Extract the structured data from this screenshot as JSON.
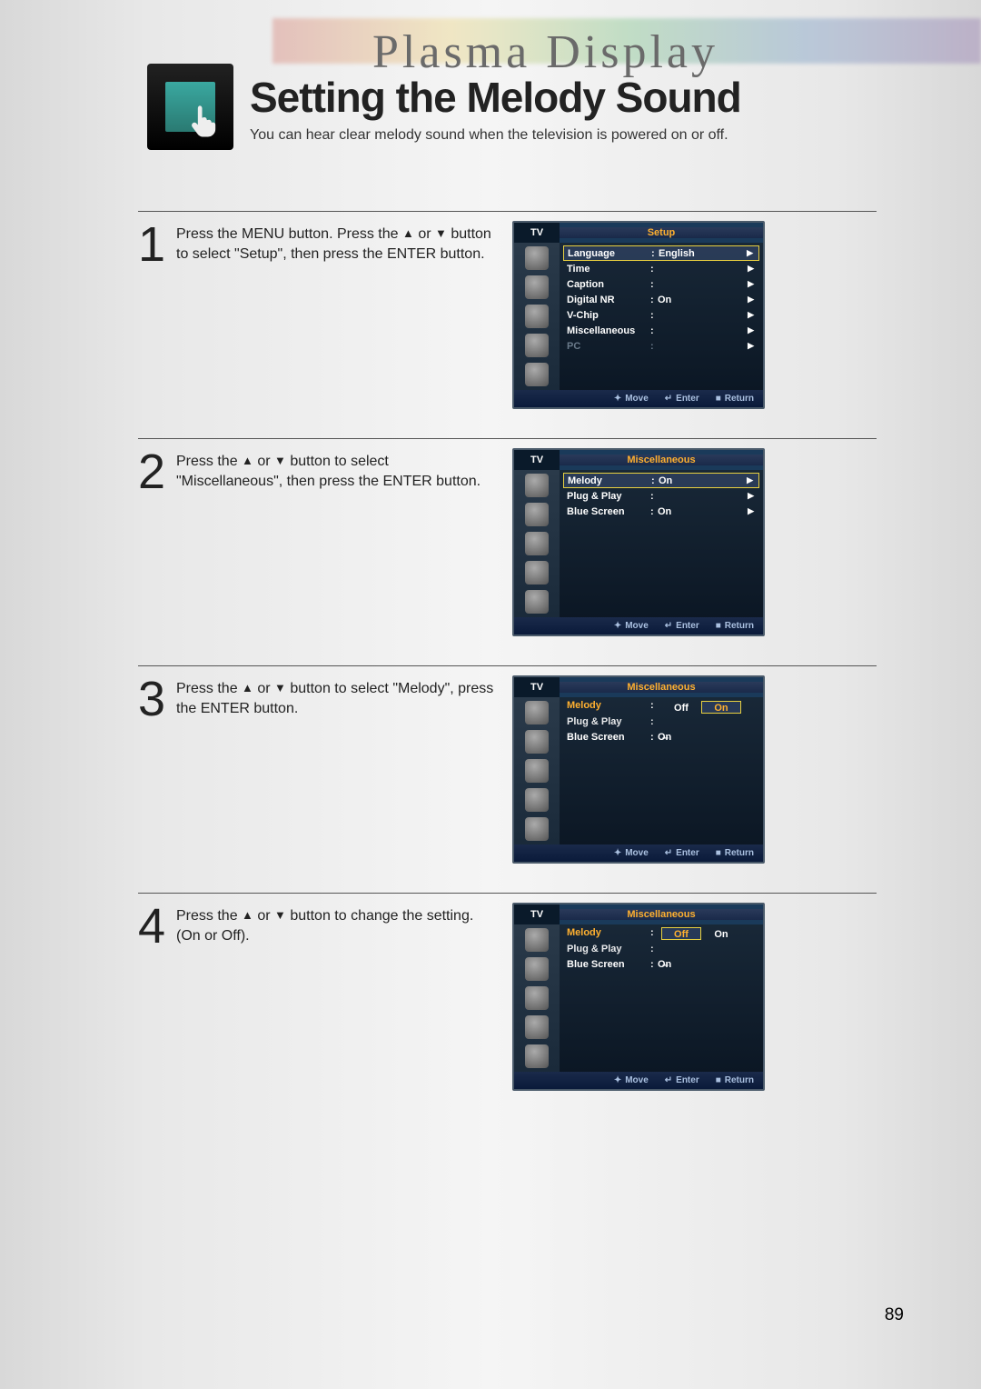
{
  "header": {
    "brand": "Plasma Display",
    "title": "Setting the Melody Sound",
    "subtitle": "You can hear clear melody sound when the television is powered on or off."
  },
  "arrows": {
    "up": "▲",
    "down": "▼",
    "right": "▶"
  },
  "footer_hints": {
    "move": "Move",
    "enter": "Enter",
    "return": "Return"
  },
  "page_number": "89",
  "steps": [
    {
      "num": "1",
      "text_parts": [
        "Press the MENU button. Press the ",
        "▲",
        " or ",
        "▼",
        " button to select \"Setup\", then press the ENTER button."
      ],
      "osd": {
        "tv": "TV",
        "title": "Setup",
        "rows": [
          {
            "label": "Language",
            "value": "English",
            "tri": true,
            "highlight": true
          },
          {
            "label": "Time",
            "value": "",
            "tri": true
          },
          {
            "label": "Caption",
            "value": "",
            "tri": true
          },
          {
            "label": "Digital NR",
            "value": "On",
            "tri": true
          },
          {
            "label": "V-Chip",
            "value": "",
            "tri": true
          },
          {
            "label": "Miscellaneous",
            "value": "",
            "tri": true
          },
          {
            "label": "PC",
            "value": "",
            "tri": true,
            "dim": true
          }
        ]
      }
    },
    {
      "num": "2",
      "text_parts": [
        "Press the ",
        "▲",
        " or ",
        "▼",
        " button to select \"Miscellaneous\", then press the ENTER button."
      ],
      "osd": {
        "tv": "TV",
        "title": "Miscellaneous",
        "rows": [
          {
            "label": "Melody",
            "value": "On",
            "tri": true,
            "highlight": true
          },
          {
            "label": "Plug & Play",
            "value": "",
            "tri": true
          },
          {
            "label": "Blue Screen",
            "value": "On",
            "tri": true
          }
        ]
      }
    },
    {
      "num": "3",
      "text_parts": [
        "Press the ",
        "▲",
        " or ",
        "▼",
        " button to select \"Melody\", press the ENTER button."
      ],
      "osd": {
        "tv": "TV",
        "title": "Miscellaneous",
        "rows": [
          {
            "label": "Melody",
            "amber": true,
            "options": [
              "Off",
              "On"
            ],
            "hl_index": 1,
            "underlying": ""
          },
          {
            "label": "Plug & Play",
            "value": "",
            "tri": false,
            "covered": true
          },
          {
            "label": "Blue Screen",
            "value": "On",
            "tri": false,
            "strike": true
          }
        ]
      }
    },
    {
      "num": "4",
      "text_parts": [
        "Press the ",
        "▲",
        " or ",
        "▼",
        " button to change the setting.",
        " (On or Off)."
      ],
      "osd": {
        "tv": "TV",
        "title": "Miscellaneous",
        "rows": [
          {
            "label": "Melody",
            "amber": true,
            "options": [
              "Off",
              "On"
            ],
            "hl_index": 0,
            "underlying": ""
          },
          {
            "label": "Plug & Play",
            "value": "",
            "tri": false,
            "covered": true
          },
          {
            "label": "Blue Screen",
            "value": "On",
            "tri": false,
            "strike": true
          }
        ]
      }
    }
  ]
}
